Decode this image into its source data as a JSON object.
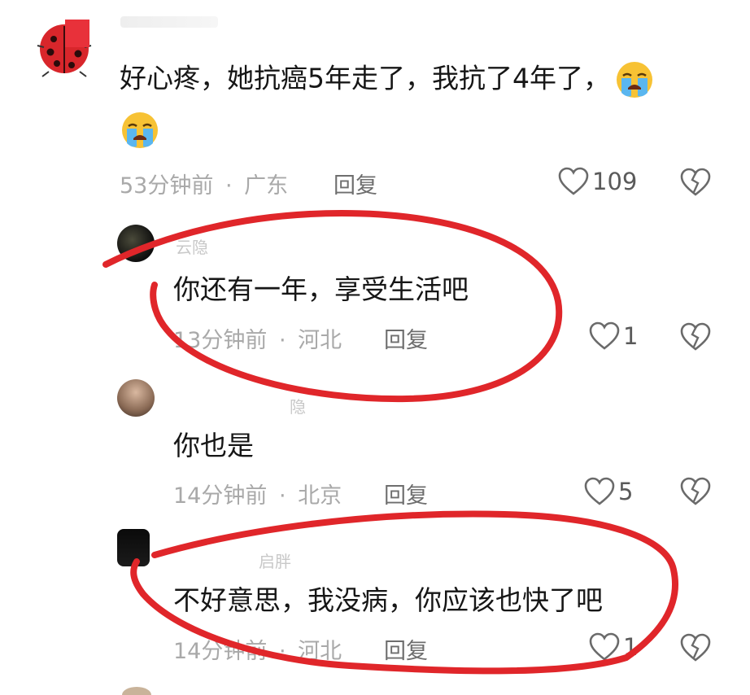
{
  "comments": [
    {
      "avatar": "ladybug-avatar",
      "text_line1": "好心疼，她抗癌5年走了，我抗了4年了，",
      "time": "53分钟前",
      "sep": "·",
      "location": "广东",
      "reply_label": "回复",
      "likes": "109"
    },
    {
      "username": "云隐",
      "text": "你还有一年，享受生活吧",
      "time": "13分钟前",
      "sep": "·",
      "location": "河北",
      "reply_label": "回复",
      "likes": "1"
    },
    {
      "username": "隐",
      "text": "你也是",
      "time": "14分钟前",
      "sep": "·",
      "location": "北京",
      "reply_label": "回复",
      "likes": "5"
    },
    {
      "username": "启胖",
      "text": "不好意思，我没病，你应该也快了吧",
      "time": "14分钟前",
      "sep": "·",
      "location": "河北",
      "reply_label": "回复",
      "likes": "1"
    }
  ],
  "icons": {
    "emoji": "loudly-crying-face-icon",
    "like": "heart-outline-icon",
    "dislike": "broken-heart-icon"
  },
  "colors": {
    "annotation": "#e0262a",
    "meta_text": "#a9a9a9",
    "body_text": "#161616"
  }
}
